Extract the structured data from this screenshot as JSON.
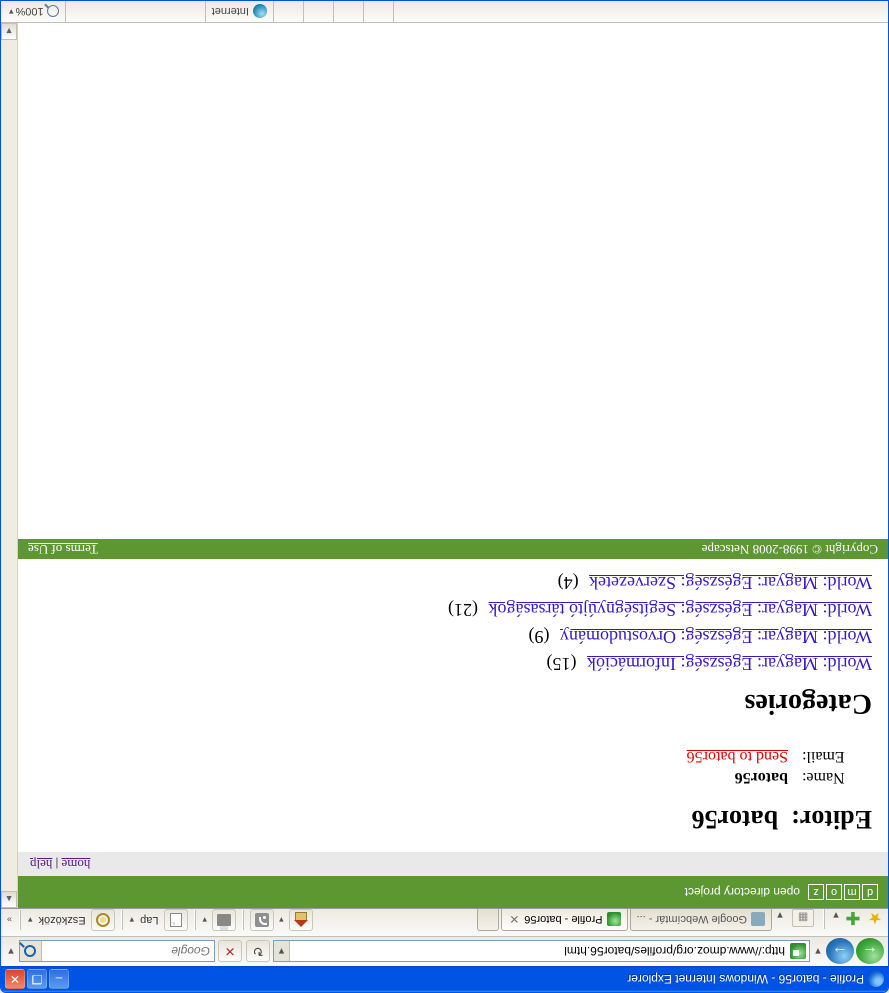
{
  "window": {
    "title": "Profile - bator56 - Windows Internet Explorer"
  },
  "nav": {
    "url": "http://www.dmoz.org/profiles/bator56.html",
    "search_placeholder": "Google",
    "refresh_tip": "Refresh",
    "stop_tip": "Stop"
  },
  "tabs": [
    {
      "label": "Google Webcímtár - ...",
      "active": false
    },
    {
      "label": "Profile - bator56",
      "active": true
    }
  ],
  "toolbar": {
    "page_label": "Lap",
    "tools_label": "Eszközök"
  },
  "dmoz": {
    "logo": [
      "d",
      "m",
      "o",
      "z"
    ],
    "tag": "open directory project",
    "nav": {
      "home": "home",
      "help": "help",
      "sep": " | "
    },
    "editor_label": "Editor:",
    "editor_value": "bator56",
    "rows": [
      {
        "k": "Name:",
        "v": "bator56",
        "link": false
      },
      {
        "k": "Email:",
        "v": "Send to bator56",
        "link": true
      }
    ],
    "cats_head": "Categories",
    "cats": [
      {
        "label": "World: Magyar: Egészség: Információk",
        "count": "(15)"
      },
      {
        "label": "World: Magyar: Egészség: Orvostudomány",
        "count": "(9)"
      },
      {
        "label": "World: Magyar: Egészség: Segítségnyújtó társaságok",
        "count": "(21)"
      },
      {
        "label": "World: Magyar: Egészség: Szervezetek",
        "count": "(4)"
      }
    ],
    "footer": {
      "copyright": "Copyright © 1998-2008 Netscape",
      "terms": "Terms of Use"
    }
  },
  "status": {
    "zone": "Internet",
    "zoom": "100%"
  }
}
